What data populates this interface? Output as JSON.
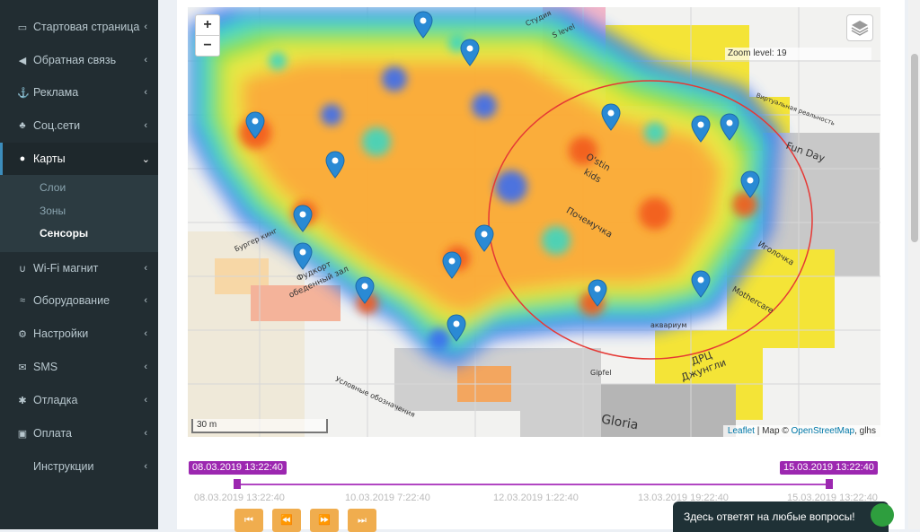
{
  "sidebar": {
    "items": [
      {
        "label": "Стартовая страница",
        "icon": "desktop-icon"
      },
      {
        "label": "Обратная связь",
        "icon": "bullhorn-icon"
      },
      {
        "label": "Реклама",
        "icon": "anchor-icon"
      },
      {
        "label": "Соц.сети",
        "icon": "thumbs-up-icon"
      },
      {
        "label": "Карты",
        "icon": "map-marker-icon"
      },
      {
        "label": "Wi-Fi магнит",
        "icon": "magnet-icon"
      },
      {
        "label": "Оборудование",
        "icon": "wifi-icon"
      },
      {
        "label": "Настройки",
        "icon": "cogs-icon"
      },
      {
        "label": "SMS",
        "icon": "envelope-icon"
      },
      {
        "label": "Отладка",
        "icon": "bug-icon"
      },
      {
        "label": "Оплата",
        "icon": "money-icon"
      },
      {
        "label": "Инструкции",
        "icon": ""
      }
    ],
    "submenu": [
      {
        "label": "Слои"
      },
      {
        "label": "Зоны"
      },
      {
        "label": "Сенсоры"
      }
    ]
  },
  "map": {
    "zoom_in": "+",
    "zoom_out": "−",
    "zoom_level": "Zoom level: 19",
    "scale": "30 m",
    "attribution": {
      "leaflet": "Leaflet",
      "sep": " | Map © ",
      "osm": "OpenStreetMap",
      "tail": ", glhs"
    },
    "labels": {
      "fun_day": "Fun Day",
      "igolochka": "Иголочка",
      "mothercare": "Mothercare",
      "drc": "ДРЦ",
      "jungle": "Джунгли",
      "gloria": "Gloria",
      "gipfel": "Gipfel",
      "fudkort": "Фудкорт",
      "obedenny": "обеденный зал",
      "burger": "Бургер кинг",
      "studio": "Студия",
      "s_level": "S level",
      "ostin": "O'stin",
      "kids": "kids",
      "pochemuchka": "Почемучка",
      "akvarium": "аквариум",
      "legend_title": "Условные обозначения",
      "virt": "Виртуальная реальность"
    },
    "accent_color": "#3c8dbc",
    "zone_circle_color": "#e53935"
  },
  "timeline": {
    "start_badge": "08.03.2019 13:22:40",
    "end_badge": "15.03.2019 13:22:40",
    "ticks": [
      "08.03.2019 13:22:40",
      "10.03.2019 7:22:40",
      "12.03.2019 1:22:40",
      "13.03.2019 19:22:40",
      "15.03.2019 13:22:40"
    ],
    "controls": [
      "fast-backward-icon",
      "backward-icon",
      "forward-icon",
      "fast-forward-icon"
    ],
    "badge_color": "#9c27b0",
    "button_color": "#f0ad4e"
  },
  "chat": {
    "label": "Здесь ответят на любые вопросы!"
  }
}
